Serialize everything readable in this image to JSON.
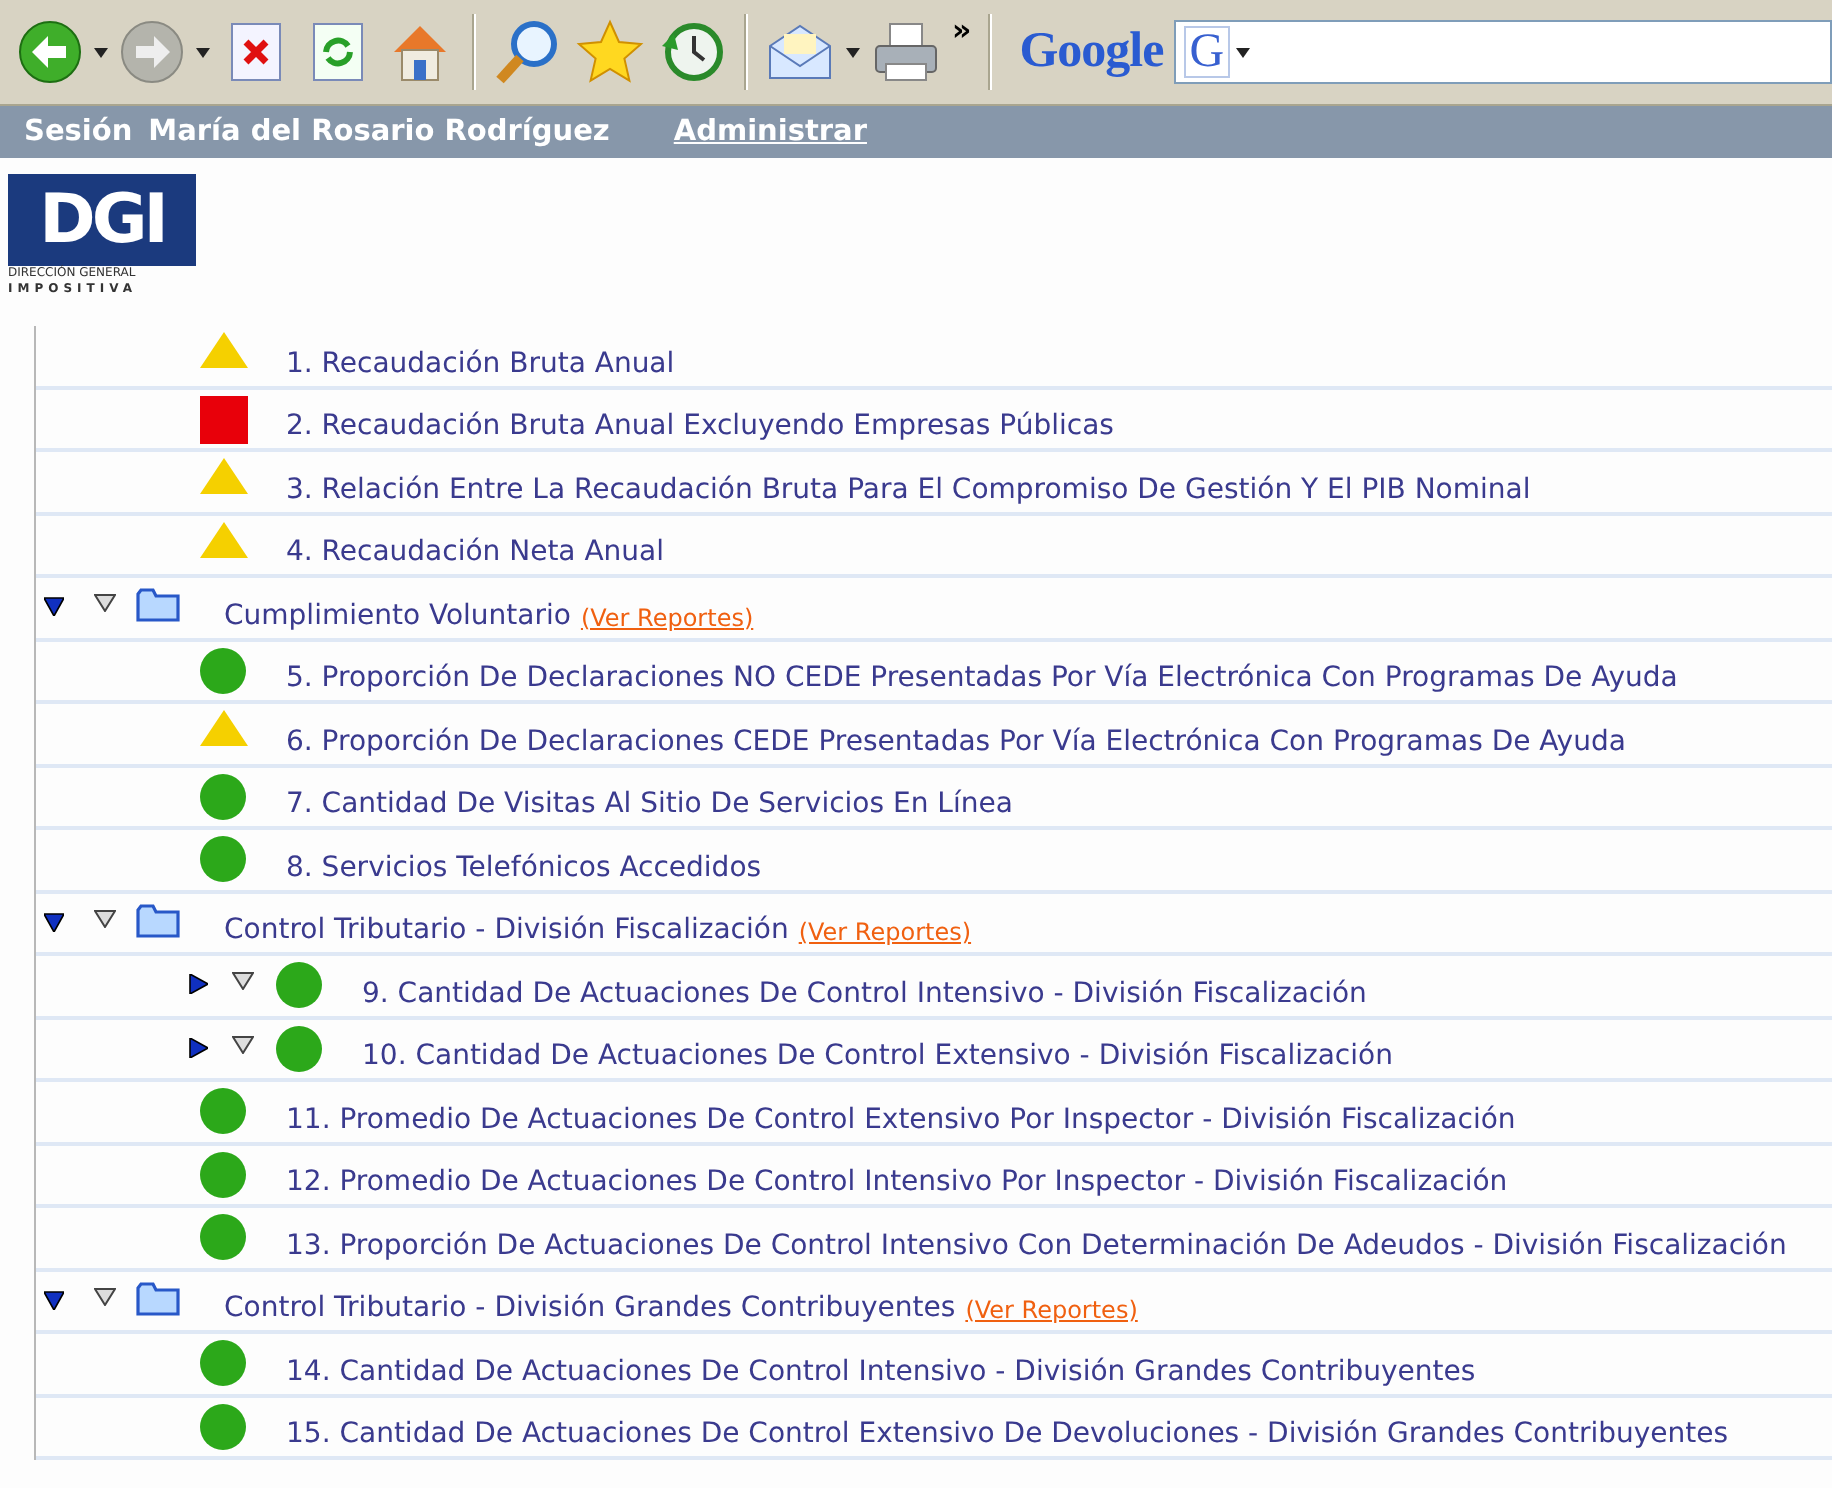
{
  "toolbar": {
    "overflow": "»",
    "search_brand": "Google",
    "search_engine_letter": "G"
  },
  "session_bar": {
    "label": "Sesión",
    "user": "María del Rosario Rodríguez",
    "link": "Administrar"
  },
  "logo": {
    "mark": "DGI",
    "line_1": "DIRECCIÓN GENERAL",
    "line_2": "IMPOSITIVA"
  },
  "tree": [
    {
      "kind": "indicator",
      "color": "#f5d000",
      "label": "1. Recaudación Bruta Anual"
    },
    {
      "kind": "indicator",
      "color": "#e8000a",
      "label": "2. Recaudación Bruta Anual Excluyendo Empresas Públicas"
    },
    {
      "kind": "indicator",
      "color": "#f5d000",
      "label": "3. Relación Entre La Recaudación Bruta Para El Compromiso De Gestión Y El PIB Nominal"
    },
    {
      "kind": "indicator",
      "color": "#f5d000",
      "label": "4. Recaudación Neta Anual"
    },
    {
      "kind": "group",
      "label": "Cumplimiento Voluntario",
      "link": "(Ver Reportes)",
      "expanded": true,
      "children": [
        {
          "kind": "indicator",
          "color": "#2ca81a",
          "label": "5. Proporción De Declaraciones NO CEDE Presentadas Por Vía Electrónica Con Programas De Ayuda"
        },
        {
          "kind": "indicator",
          "color": "#f5d000",
          "label": "6. Proporción De Declaraciones CEDE Presentadas Por Vía Electrónica Con Programas De Ayuda"
        },
        {
          "kind": "indicator",
          "color": "#2ca81a",
          "label": "7. Cantidad De Visitas Al Sitio De Servicios En Línea"
        },
        {
          "kind": "indicator",
          "color": "#2ca81a",
          "label": "8. Servicios Telefónicos Accedidos"
        }
      ]
    },
    {
      "kind": "group",
      "label": "Control Tributario - División Fiscalización",
      "link": "(Ver Reportes)",
      "expanded": true,
      "children": [
        {
          "kind": "indicator",
          "color": "#2ca81a",
          "label": "9. Cantidad De Actuaciones De Control Intensivo - División Fiscalización",
          "expanded": false
        },
        {
          "kind": "indicator",
          "color": "#2ca81a",
          "label": "10. Cantidad De Actuaciones De Control Extensivo - División Fiscalización",
          "expanded": false
        },
        {
          "kind": "indicator",
          "color": "#2ca81a",
          "label": "11. Promedio De Actuaciones De Control Extensivo Por Inspector - División Fiscalización"
        },
        {
          "kind": "indicator",
          "color": "#2ca81a",
          "label": "12. Promedio De Actuaciones De Control Intensivo Por Inspector - División Fiscalización"
        },
        {
          "kind": "indicator",
          "color": "#2ca81a",
          "label": "13. Proporción De Actuaciones De Control Intensivo Con Determinación De Adeudos - División Fiscalización"
        }
      ]
    },
    {
      "kind": "group",
      "label": "Control Tributario - División Grandes Contribuyentes",
      "link": "(Ver Reportes)",
      "expanded": true,
      "children": [
        {
          "kind": "indicator",
          "color": "#2ca81a",
          "label": "14. Cantidad De Actuaciones De Control Intensivo - División Grandes Contribuyentes"
        },
        {
          "kind": "indicator",
          "color": "#2ca81a",
          "label": "15. Cantidad De Actuaciones De Control Extensivo De Devoluciones - División Grandes Contribuyentes"
        }
      ]
    }
  ]
}
